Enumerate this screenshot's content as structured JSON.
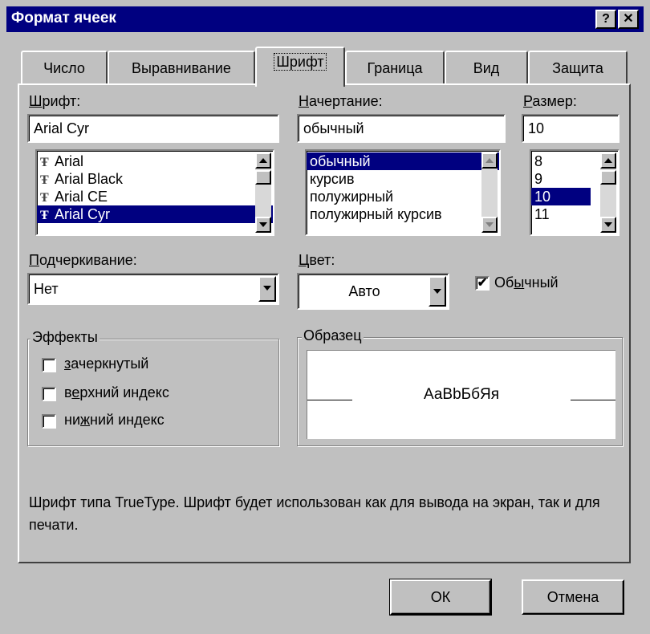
{
  "window": {
    "title": "Формат ячеек",
    "help_btn": "?",
    "close_btn": "✕"
  },
  "tabs": [
    {
      "label": "Число",
      "active": false
    },
    {
      "label": "Выравнивание",
      "active": false
    },
    {
      "label": "Шрифт",
      "active": true
    },
    {
      "label": "Граница",
      "active": false
    },
    {
      "label": "Вид",
      "active": false
    },
    {
      "label": "Защита",
      "active": false
    }
  ],
  "font": {
    "label_u": "Ш",
    "label_rest": "рифт:",
    "value": "Arial Cyr",
    "items": [
      "Arial",
      "Arial Black",
      "Arial CE",
      "Arial Cyr"
    ],
    "selected_index": 3,
    "icon": "truetype-icon"
  },
  "style": {
    "label_u": "Н",
    "label_rest": "ачертание:",
    "value": "обычный",
    "items": [
      "обычный",
      "курсив",
      "полужирный",
      "полужирный курсив"
    ],
    "selected_index": 0
  },
  "size": {
    "label_u": "Р",
    "label_rest": "азмер:",
    "value": "10",
    "items": [
      "8",
      "9",
      "10",
      "11"
    ],
    "selected_index": 2
  },
  "underline": {
    "label_u": "П",
    "label_rest": "одчеркивание:",
    "value": "Нет"
  },
  "color": {
    "label_u": "Ц",
    "label_rest": "вет:",
    "value": "Авто"
  },
  "normal_font": {
    "checked": true,
    "label_pre": "Об",
    "label_u": "ы",
    "label_post": "чный"
  },
  "effects": {
    "title": "Эффекты",
    "items": [
      {
        "pre": "",
        "u": "з",
        "post": "ачеркнутый",
        "checked": false
      },
      {
        "pre": "в",
        "u": "е",
        "post": "рхний индекс",
        "checked": false
      },
      {
        "pre": "ни",
        "u": "ж",
        "post": "ний индекс",
        "checked": false
      }
    ]
  },
  "sample": {
    "title": "Образец",
    "text": "АаВbБбЯя"
  },
  "info_text": "Шрифт типа TrueType. Шрифт будет использован как для вывода на экран, так и для печати.",
  "buttons": {
    "ok": "ОК",
    "cancel": "Отмена"
  },
  "colors": {
    "title_bar": "#000080",
    "face": "#c0c0c0",
    "selection": "#000080"
  }
}
